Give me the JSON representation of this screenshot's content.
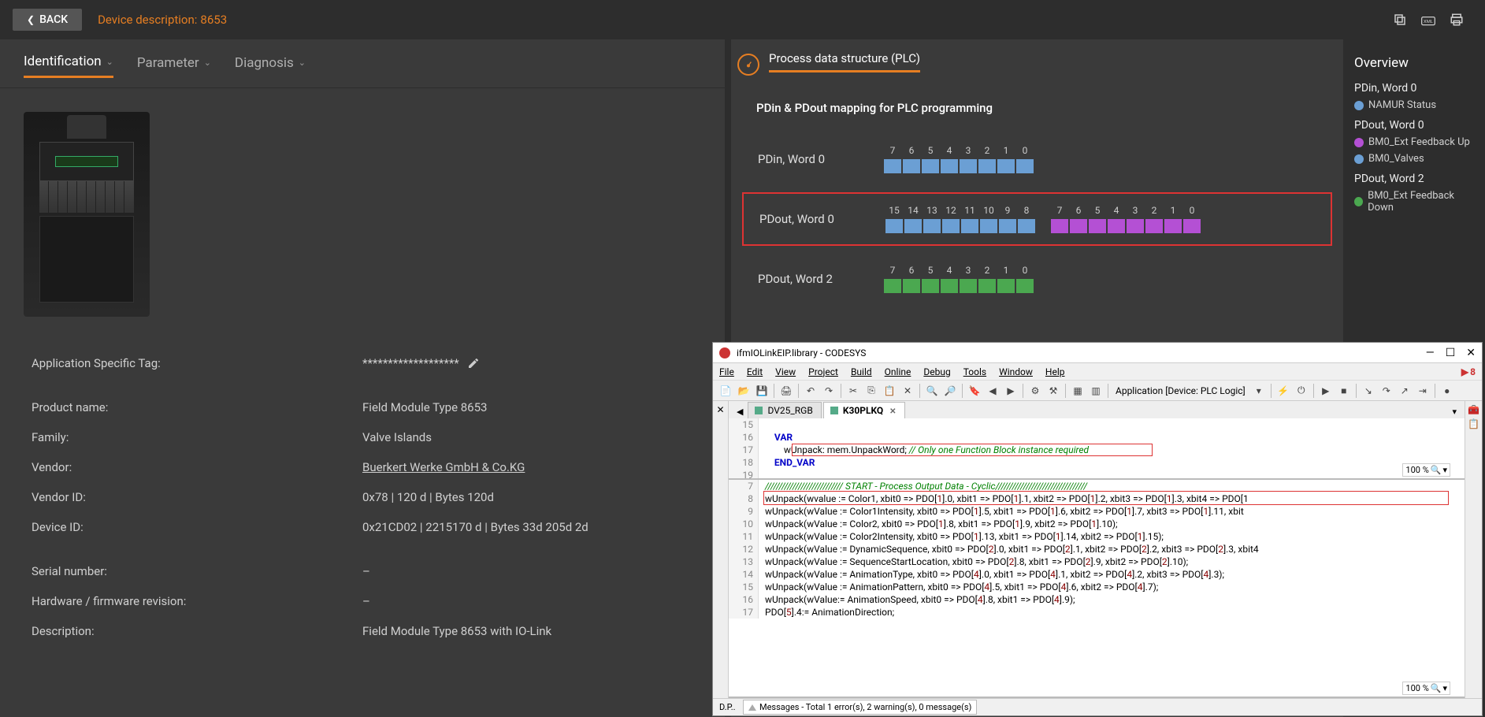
{
  "topbar": {
    "back": "BACK",
    "desc_label": "Device description:",
    "desc_value": "8653"
  },
  "tabs": {
    "identification": "Identification",
    "parameter": "Parameter",
    "diagnosis": "Diagnosis"
  },
  "details": {
    "tag_label": "Application Specific Tag:",
    "tag_value": "*******************",
    "product_label": "Product name:",
    "product_value": "Field Module Type 8653",
    "family_label": "Family:",
    "family_value": "Valve Islands",
    "vendor_label": "Vendor:",
    "vendor_value": "Buerkert Werke GmbH & Co.KG",
    "vendorid_label": "Vendor ID:",
    "vendorid_value": "0x78 | 120 d | Bytes 120d",
    "deviceid_label": "Device ID:",
    "deviceid_value": "0x21CD02 | 2215170 d | Bytes 33d 205d 2d",
    "serial_label": "Serial number:",
    "serial_value": "–",
    "hwrev_label": "Hardware / firmware revision:",
    "hwrev_value": "–",
    "desc_label": "Description:",
    "desc_value": "Field Module Type 8653 with IO-Link"
  },
  "pds": {
    "header": "Process data structure (PLC)",
    "mapping_title": "PDin & PDout mapping for PLC programming",
    "pdin0": "PDin, Word 0",
    "pdout0": "PDout, Word 0",
    "pdout2": "PDout, Word 2",
    "bits_hi": [
      "15",
      "14",
      "13",
      "12",
      "11",
      "10",
      "9",
      "8"
    ],
    "bits_lo": [
      "7",
      "6",
      "5",
      "4",
      "3",
      "2",
      "1",
      "0"
    ]
  },
  "overview": {
    "title": "Overview",
    "s1": "PDin, Word 0",
    "s1i1": "NAMUR Status",
    "s2": "PDout, Word 0",
    "s2i1": "BM0_Ext Feedback Up",
    "s2i2": "BM0_Valves",
    "s3": "PDout, Word 2",
    "s3i1": "BM0_Ext Feedback Down"
  },
  "codesys": {
    "title": "ifmIOLinkEIP.library - CODESYS",
    "notif_count": "8",
    "menu": {
      "file": "File",
      "edit": "Edit",
      "view": "View",
      "project": "Project",
      "build": "Build",
      "online": "Online",
      "debug": "Debug",
      "tools": "Tools",
      "window": "Window",
      "help": "Help"
    },
    "app_ctx": "Application [Device: PLC Logic]",
    "tab1": "DV25_RGB",
    "tab2": "K30PLKQ",
    "zoom": "100 %",
    "status_left": "D.P..",
    "messages": "Messages - Total 1 error(s), 2 warning(s), 0 message(s)",
    "code_top": [
      {
        "n": "15",
        "t": "    "
      },
      {
        "n": "16",
        "t": "    VAR",
        "cls": "kw"
      },
      {
        "n": "17",
        "t": "        wUnpack: mem.UnpackWord; // Only one Function Block instance required",
        "mix": true
      },
      {
        "n": "18",
        "t": "    END_VAR",
        "cls": "kw"
      },
      {
        "n": "19",
        "t": ""
      }
    ],
    "code_bot": [
      {
        "n": "7",
        "t": "//////////////////////////// START - Process Output Data - Cyclic/////////////////////////////////",
        "cmt": true
      },
      {
        "n": "8",
        "t": "wUnpack(wvalue := Color1, xbit0 => PDO[1].0, xbit1 => PDO[1].1, xbit2 => PDO[1].2, xbit3 => PDO[1].3, xbit4 => PDO[1"
      },
      {
        "n": "9",
        "t": "wUnpack(wValue := Color1Intensity, xbit0 => PDO[1].5, xbit1 => PDO[1].6, xbit2 => PDO[1].7, xbit3 => PDO[1].11, xbit"
      },
      {
        "n": "10",
        "t": "wUnpack(wValue := Color2, xbit0 => PDO[1].8, xbit1 => PDO[1].9, xbit2 => PDO[1].10);"
      },
      {
        "n": "11",
        "t": "wUnpack(wValue := Color2Intensity, xbit0 => PDO[1].13, xbit1 => PDO[1].14, xbit2 => PDO[1].15);"
      },
      {
        "n": "12",
        "t": "wUnpack(wValue := DynamicSequence, xbit0 => PDO[2].0, xbit1 => PDO[2].1, xbit2 => PDO[2].2, xbit3 => PDO[2].3, xbit4"
      },
      {
        "n": "13",
        "t": "wUnpack(wValue := SequenceStartLocation, xbit0 => PDO[2].8, xbit1 => PDO[2].9, xbit2 => PDO[2].10);"
      },
      {
        "n": "14",
        "t": "wUnpack(wValue := AnimationType, xbit0 => PDO[4].0, xbit1 => PDO[4].1, xbit2 => PDO[4].2, xbit3 => PDO[4].3);"
      },
      {
        "n": "15",
        "t": "wUnpack(wValue := AnimationPattern, xbit0 => PDO[4].5, xbit1 => PDO[4].6, xbit2 => PDO[4].7);"
      },
      {
        "n": "16",
        "t": "wUnpack(wValue:= AnimationSpeed, xbit0 => PDO[4].8, xbit1 => PDO[4].9);"
      },
      {
        "n": "17",
        "t": "PDO[5].4:= AnimationDirection;"
      }
    ]
  }
}
